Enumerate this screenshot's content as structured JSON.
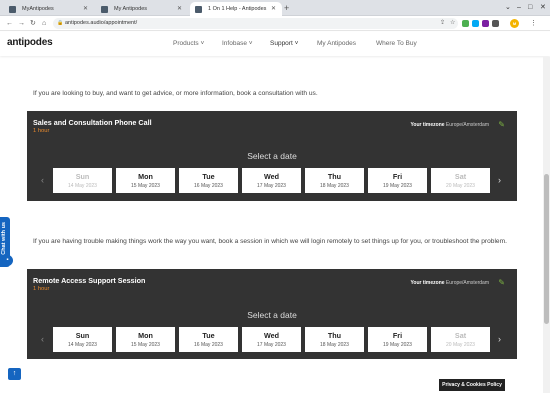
{
  "browser": {
    "tabs": [
      {
        "title": "MyAntipodes",
        "active": false
      },
      {
        "title": "My Antipodes",
        "active": false
      },
      {
        "title": "1 On 1 Help - Antipodes",
        "active": true
      }
    ],
    "url": "antipodes.audio/appointment/"
  },
  "site": {
    "logo": "antipodes",
    "nav": [
      "Products",
      "Infobase",
      "Support",
      "My Antipodes",
      "Where To Buy"
    ]
  },
  "sections": [
    {
      "intro": "If you are looking to buy, and want to get advice, or more information, book a consultation with us.",
      "title": "Sales and Consultation Phone Call",
      "duration": "1 hour",
      "timezone_label": "Your timezone",
      "timezone_value": "Europe/Amsterdam",
      "select_label": "Select a date",
      "days": [
        {
          "name": "Sun",
          "date": "14 May 2023",
          "disabled": true
        },
        {
          "name": "Mon",
          "date": "15 May 2023",
          "disabled": false
        },
        {
          "name": "Tue",
          "date": "16 May 2023",
          "disabled": false
        },
        {
          "name": "Wed",
          "date": "17 May 2023",
          "disabled": false
        },
        {
          "name": "Thu",
          "date": "18 May 2023",
          "disabled": false
        },
        {
          "name": "Fri",
          "date": "19 May 2023",
          "disabled": false
        },
        {
          "name": "Sat",
          "date": "20 May 2023",
          "disabled": true
        }
      ]
    },
    {
      "intro": "If you are having trouble making things work the way you want, book a session in which we will login remotely to set things up for you, or troubleshoot the problem.",
      "title": "Remote Access Support Session",
      "duration": "1 hour",
      "timezone_label": "Your timezone",
      "timezone_value": "Europe/Amsterdam",
      "select_label": "Select a date",
      "days": [
        {
          "name": "Sun",
          "date": "14 May 2023",
          "disabled": false
        },
        {
          "name": "Mon",
          "date": "15 May 2023",
          "disabled": false
        },
        {
          "name": "Tue",
          "date": "16 May 2023",
          "disabled": false
        },
        {
          "name": "Wed",
          "date": "17 May 2023",
          "disabled": false
        },
        {
          "name": "Thu",
          "date": "18 May 2023",
          "disabled": false
        },
        {
          "name": "Fri",
          "date": "19 May 2023",
          "disabled": false
        },
        {
          "name": "Sat",
          "date": "20 May 2023",
          "disabled": true
        }
      ]
    }
  ],
  "chat_label": "Chat with us",
  "privacy_label": "Privacy & Cookies Policy",
  "colors": {
    "panel": "#333333",
    "accent": "#e88a2e",
    "chat": "#1565c0"
  }
}
